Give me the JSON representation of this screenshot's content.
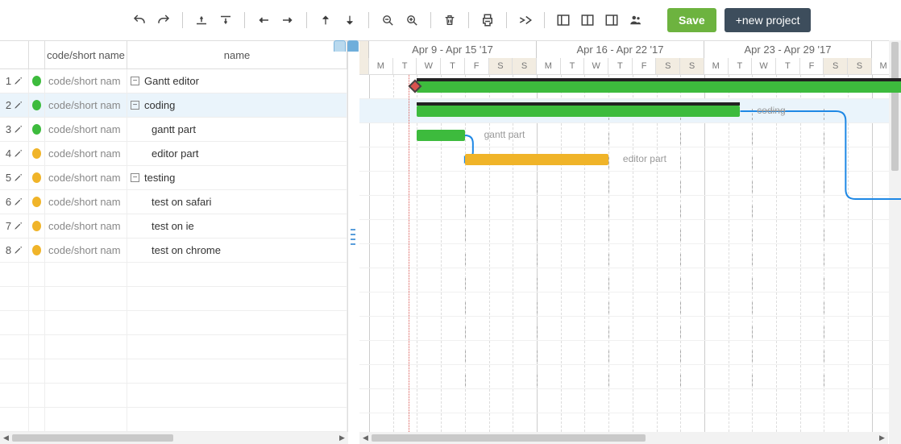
{
  "toolbar": {
    "save_label": "Save",
    "new_project_label": "+new project"
  },
  "columns": {
    "code": "code/short name",
    "name": "name"
  },
  "tasks": [
    {
      "idx": 1,
      "status": "green",
      "code": "code/short nam",
      "name": "Gantt editor",
      "group": true,
      "indent": 0
    },
    {
      "idx": 2,
      "status": "green",
      "code": "code/short nam",
      "name": "coding",
      "group": true,
      "indent": 0,
      "selected": true
    },
    {
      "idx": 3,
      "status": "green",
      "code": "code/short nam",
      "name": "gantt part",
      "group": false,
      "indent": 1
    },
    {
      "idx": 4,
      "status": "yellow",
      "code": "code/short nam",
      "name": "editor part",
      "group": false,
      "indent": 1
    },
    {
      "idx": 5,
      "status": "yellow",
      "code": "code/short nam",
      "name": "testing",
      "group": true,
      "indent": 0
    },
    {
      "idx": 6,
      "status": "yellow",
      "code": "code/short nam",
      "name": "test on safari",
      "group": false,
      "indent": 1
    },
    {
      "idx": 7,
      "status": "yellow",
      "code": "code/short nam",
      "name": "test on ie",
      "group": false,
      "indent": 1
    },
    {
      "idx": 8,
      "status": "yellow",
      "code": "code/short nam",
      "name": "test on chrome",
      "group": false,
      "indent": 1
    }
  ],
  "timeline": {
    "weeks": [
      "Apr 9 - Apr 15 '17",
      "Apr 16 - Apr 22 '17",
      "Apr 23 - Apr 29 '17"
    ],
    "day_letters": [
      "M",
      "T",
      "W",
      "T",
      "F",
      "S",
      "S"
    ]
  },
  "bars": {
    "task2_label": "coding",
    "task3_label": "gantt part",
    "task4_label": "editor part"
  },
  "colors": {
    "green": "#3dbb3d",
    "yellow": "#f0b429",
    "link": "#1e88e5",
    "today": "#d9534f"
  },
  "chart_data": {
    "type": "gantt",
    "date_range": {
      "start": "2017-04-09",
      "end": "2017-04-30"
    },
    "today": "2017-04-11",
    "tasks": [
      {
        "id": 1,
        "name": "Gantt editor",
        "start": "2017-04-11",
        "end": "2017-04-30",
        "type": "summary",
        "status": "green",
        "milestone_at": "2017-04-11"
      },
      {
        "id": 2,
        "name": "coding",
        "start": "2017-04-11",
        "end": "2017-04-24",
        "type": "summary",
        "status": "green",
        "parent": 1
      },
      {
        "id": 3,
        "name": "gantt part",
        "start": "2017-04-11",
        "end": "2017-04-12",
        "type": "task",
        "status": "green",
        "parent": 2
      },
      {
        "id": 4,
        "name": "editor part",
        "start": "2017-04-13",
        "end": "2017-04-18",
        "type": "task",
        "status": "yellow",
        "parent": 2
      },
      {
        "id": 5,
        "name": "testing",
        "start": null,
        "end": null,
        "type": "summary",
        "status": "yellow",
        "parent": 1
      },
      {
        "id": 6,
        "name": "test on safari",
        "start": null,
        "end": null,
        "type": "task",
        "status": "yellow",
        "parent": 5
      },
      {
        "id": 7,
        "name": "test on ie",
        "start": null,
        "end": null,
        "type": "task",
        "status": "yellow",
        "parent": 5
      },
      {
        "id": 8,
        "name": "test on chrome",
        "start": null,
        "end": null,
        "type": "task",
        "status": "yellow",
        "parent": 5
      }
    ],
    "dependencies": [
      {
        "from": 3,
        "to": 4,
        "type": "finish-to-start"
      },
      {
        "from": 2,
        "to": 5,
        "type": "finish-to-start"
      }
    ]
  }
}
